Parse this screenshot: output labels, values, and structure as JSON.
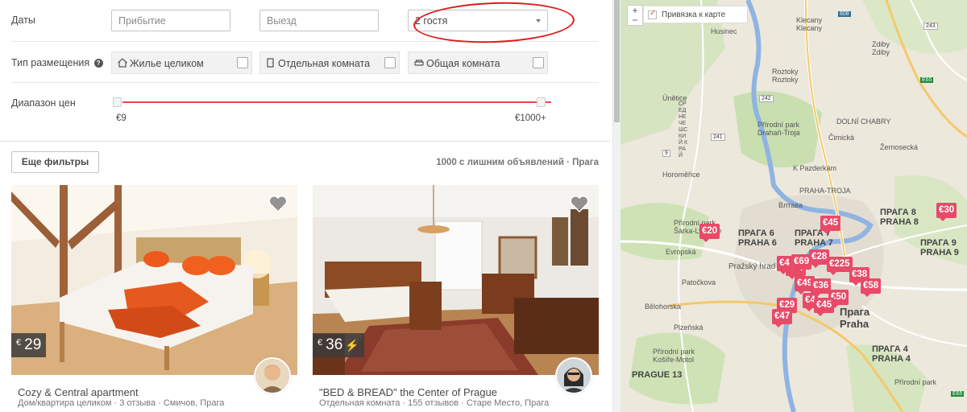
{
  "filters": {
    "dates_label": "Даты",
    "checkin_placeholder": "Прибытие",
    "checkout_placeholder": "Выезд",
    "guests_value": "2 гостя",
    "room_type_label": "Тип размещения",
    "room_types": [
      {
        "label": "Жилье целиком",
        "icon": "house-icon"
      },
      {
        "label": "Отдельная комната",
        "icon": "door-icon"
      },
      {
        "label": "Общая комната",
        "icon": "sofa-icon"
      }
    ],
    "price_label": "Диапазон цен",
    "price_min": "€9",
    "price_max": "€1000+"
  },
  "more_filters_label": "Еще фильтры",
  "results_count": "1000 с лишним объявлений · Прага",
  "listings": [
    {
      "currency": "€",
      "price": "29",
      "instant_book": false,
      "title": "Cozy & Central apartment",
      "subtitle": "Дом/квартира целиком · 3 отзыва · Смичов, Прага"
    },
    {
      "currency": "€",
      "price": "36",
      "instant_book": true,
      "title": "\"BED & BREAD\" the Center of Prague",
      "subtitle": "Отдельная комната · 155 отзывов · Старе Место, Прага"
    }
  ],
  "map": {
    "zoom_in": "+",
    "zoom_out": "−",
    "move_with_map_label": "Привязка к карте",
    "labels": {
      "husinec": "Husinec",
      "klecany": "Klecany\nKlecany",
      "zdiby": "Zdiby\nZdiby",
      "roztoky": "Roztoky\nRoztoky",
      "unetice": "Únětice",
      "dolni_chabry": "DOLNÍ CHABRY",
      "troja": "Přírodní park\nDrahaň-Troja",
      "praha6": "ПРАГА 6\nPRAHA 6",
      "praha7": "ПРАГА 7\nPRAHA 7",
      "praha8": "ПРАГА 8\nPRAHA 8",
      "praha9": "ПРАГА 9\nPRAHA 9",
      "praha": "Прага\nPraha",
      "praha4": "ПРАГА 4\nPRAHA 4",
      "praha13": "PRAGUE 13",
      "prazsky_hrad": "Pražský hrad",
      "vltava": "Влтава",
      "sarka": "Přírodní park\nŠárka-Lysolaje",
      "kosire": "Přírodní park\nKošíře-Motol",
      "hostivar": "Přírodní park",
      "zernosecka": "Žernosecká",
      "kpazderkam": "K Pazderkám",
      "cimicka": "Čimická",
      "evropska": "Evropská",
      "patockova": "Patočkova",
      "plzenska": "Plzeňská",
      "bilohorska": "Bělohorská",
      "stredocesky": "СРЕДНЕЧЕШСКИЙ КРАЙ",
      "praha_troja": "PRAHA-TROJA",
      "horomerice": "Horoměřice"
    },
    "markers": [
      "€45",
      "€30",
      "€20",
      "€28",
      "€225",
      "€38",
      "€58",
      "€49",
      "€36",
      "€50",
      "€4",
      "€45",
      "€29",
      "€47",
      "€46",
      "€69",
      "€4"
    ],
    "road_numbers": [
      "608",
      "243",
      "242",
      "241",
      "9",
      "E65",
      "E65"
    ]
  }
}
